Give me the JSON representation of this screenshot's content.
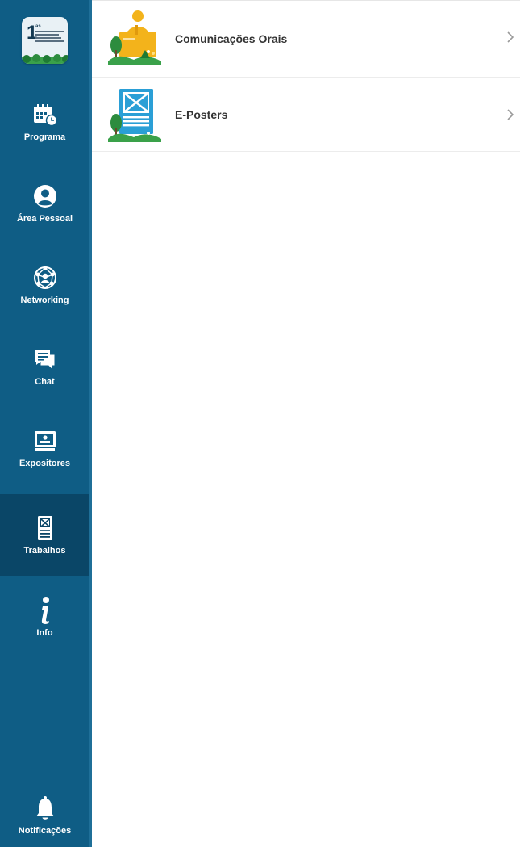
{
  "theme": {
    "sidebar_bg": "#0f5d85",
    "sidebar_active_bg": "#0a4667",
    "icon_color": "#ffffff",
    "accent_blue": "#2a9fd6",
    "accent_yellow": "#f3b31b",
    "accent_green": "#3aa14a"
  },
  "logo": {
    "number": "1",
    "superscript": "as"
  },
  "sidebar": {
    "items": [
      {
        "label": "Programa",
        "icon": "calendar-clock-icon"
      },
      {
        "label": "Área Pessoal",
        "icon": "user-circle-icon"
      },
      {
        "label": "Networking",
        "icon": "network-globe-icon"
      },
      {
        "label": "Chat",
        "icon": "chat-bubbles-icon"
      },
      {
        "label": "Expositores",
        "icon": "booth-monitor-icon"
      },
      {
        "label": "Trabalhos",
        "icon": "poster-document-icon",
        "active": true
      },
      {
        "label": "Info",
        "icon": "info-icon"
      },
      {
        "label": "Notificações",
        "icon": "bell-icon"
      }
    ]
  },
  "main": {
    "items": [
      {
        "label": "Comunicações Orais",
        "icon": "speaker-podium-illustration"
      },
      {
        "label": "E-Posters",
        "icon": "poster-board-illustration"
      }
    ]
  }
}
